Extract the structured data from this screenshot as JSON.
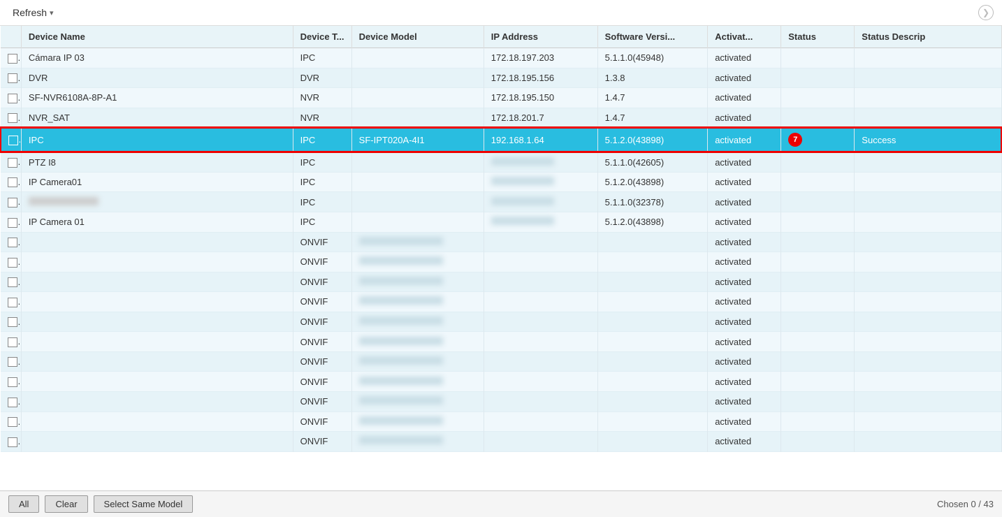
{
  "header": {
    "refresh_label": "Refresh",
    "circle_arrow": "❯"
  },
  "columns": [
    {
      "key": "checkbox",
      "label": ""
    },
    {
      "key": "device_name",
      "label": "Device Name"
    },
    {
      "key": "device_type",
      "label": "Device T..."
    },
    {
      "key": "device_model",
      "label": "Device Model"
    },
    {
      "key": "ip_address",
      "label": "IP Address"
    },
    {
      "key": "software_version",
      "label": "Software Versi..."
    },
    {
      "key": "activation",
      "label": "Activat..."
    },
    {
      "key": "status",
      "label": "Status"
    },
    {
      "key": "status_desc",
      "label": "Status Descrip"
    }
  ],
  "rows": [
    {
      "id": 1,
      "device_name": "Cámara IP 03",
      "device_type": "IPC",
      "device_model": "",
      "ip_address": "172.18.197.203",
      "software_version": "5.1.1.0(45948)",
      "activation": "activated",
      "status": "",
      "status_desc": "",
      "selected": false,
      "blurred_model": false,
      "blurred_ip": false
    },
    {
      "id": 2,
      "device_name": "DVR",
      "device_type": "DVR",
      "device_model": "",
      "ip_address": "172.18.195.156",
      "software_version": "1.3.8",
      "activation": "activated",
      "status": "",
      "status_desc": "",
      "selected": false,
      "blurred_model": false,
      "blurred_ip": false
    },
    {
      "id": 3,
      "device_name": "SF-NVR6108A-8P-A1",
      "device_type": "NVR",
      "device_model": "",
      "ip_address": "172.18.195.150",
      "software_version": "1.4.7",
      "activation": "activated",
      "status": "",
      "status_desc": "",
      "selected": false,
      "blurred_model": false,
      "blurred_ip": false
    },
    {
      "id": 4,
      "device_name": "NVR_SAT",
      "device_type": "NVR",
      "device_model": "",
      "ip_address": "172.18.201.7",
      "software_version": "1.4.7",
      "activation": "activated",
      "status": "",
      "status_desc": "",
      "selected": false,
      "blurred_model": false,
      "blurred_ip": false
    },
    {
      "id": 5,
      "device_name": "IPC",
      "device_type": "IPC",
      "device_model": "SF-IPT020A-4I1",
      "ip_address": "192.168.1.64",
      "software_version": "5.1.2.0(43898)",
      "activation": "activated",
      "status": "Success",
      "status_desc": "",
      "selected": true,
      "badge": "7",
      "blurred_model": false,
      "blurred_ip": false
    },
    {
      "id": 6,
      "device_name": "PTZ I8",
      "device_type": "IPC",
      "device_model": "",
      "ip_address": "",
      "software_version": "5.1.1.0(42605)",
      "activation": "activated",
      "status": "",
      "status_desc": "",
      "selected": false,
      "blurred_model": false,
      "blurred_ip": true
    },
    {
      "id": 7,
      "device_name": "IP Camera01",
      "device_type": "IPC",
      "device_model": "",
      "ip_address": "",
      "software_version": "5.1.2.0(43898)",
      "activation": "activated",
      "status": "",
      "status_desc": "",
      "selected": false,
      "blurred_model": false,
      "blurred_ip": true
    },
    {
      "id": 8,
      "device_name": "",
      "device_type": "IPC",
      "device_model": "",
      "ip_address": "",
      "software_version": "5.1.1.0(32378)",
      "activation": "activated",
      "status": "",
      "status_desc": "",
      "selected": false,
      "blurred_model": false,
      "blurred_ip": true,
      "blurred_name": true
    },
    {
      "id": 9,
      "device_name": "IP Camera 01",
      "device_type": "IPC",
      "device_model": "",
      "ip_address": "",
      "software_version": "5.1.2.0(43898)",
      "activation": "activated",
      "status": "",
      "status_desc": "",
      "selected": false,
      "blurred_model": false,
      "blurred_ip": true
    },
    {
      "id": 10,
      "device_name": "",
      "device_type": "ONVIF",
      "device_model": "",
      "ip_address": "",
      "software_version": "",
      "activation": "activated",
      "status": "",
      "status_desc": "",
      "selected": false,
      "blurred_model": true,
      "blurred_ip": false
    },
    {
      "id": 11,
      "device_name": "",
      "device_type": "ONVIF",
      "device_model": "",
      "ip_address": "",
      "software_version": "",
      "activation": "activated",
      "status": "",
      "status_desc": "",
      "selected": false,
      "blurred_model": true,
      "blurred_ip": false
    },
    {
      "id": 12,
      "device_name": "",
      "device_type": "ONVIF",
      "device_model": "",
      "ip_address": "",
      "software_version": "",
      "activation": "activated",
      "status": "",
      "status_desc": "",
      "selected": false,
      "blurred_model": true,
      "blurred_ip": false
    },
    {
      "id": 13,
      "device_name": "",
      "device_type": "ONVIF",
      "device_model": "",
      "ip_address": "",
      "software_version": "",
      "activation": "activated",
      "status": "",
      "status_desc": "",
      "selected": false,
      "blurred_model": true,
      "blurred_ip": false
    },
    {
      "id": 14,
      "device_name": "",
      "device_type": "ONVIF",
      "device_model": "",
      "ip_address": "",
      "software_version": "",
      "activation": "activated",
      "status": "",
      "status_desc": "",
      "selected": false,
      "blurred_model": true,
      "blurred_ip": false
    },
    {
      "id": 15,
      "device_name": "",
      "device_type": "ONVIF",
      "device_model": "",
      "ip_address": "",
      "software_version": "",
      "activation": "activated",
      "status": "",
      "status_desc": "",
      "selected": false,
      "blurred_model": true,
      "blurred_ip": false
    },
    {
      "id": 16,
      "device_name": "",
      "device_type": "ONVIF",
      "device_model": "",
      "ip_address": "",
      "software_version": "",
      "activation": "activated",
      "status": "",
      "status_desc": "",
      "selected": false,
      "blurred_model": true,
      "blurred_ip": false
    },
    {
      "id": 17,
      "device_name": "",
      "device_type": "ONVIF",
      "device_model": "",
      "ip_address": "",
      "software_version": "",
      "activation": "activated",
      "status": "",
      "status_desc": "",
      "selected": false,
      "blurred_model": true,
      "blurred_ip": false
    },
    {
      "id": 18,
      "device_name": "",
      "device_type": "ONVIF",
      "device_model": "",
      "ip_address": "",
      "software_version": "",
      "activation": "activated",
      "status": "",
      "status_desc": "",
      "selected": false,
      "blurred_model": true,
      "blurred_ip": false
    },
    {
      "id": 19,
      "device_name": "",
      "device_type": "ONVIF",
      "device_model": "",
      "ip_address": "",
      "software_version": "",
      "activation": "activated",
      "status": "",
      "status_desc": "",
      "selected": false,
      "blurred_model": true,
      "blurred_ip": false
    },
    {
      "id": 20,
      "device_name": "",
      "device_type": "ONVIF",
      "device_model": "",
      "ip_address": "",
      "software_version": "",
      "activation": "activated",
      "status": "",
      "status_desc": "",
      "selected": false,
      "blurred_model": true,
      "blurred_ip": false
    }
  ],
  "footer": {
    "all_label": "All",
    "clear_label": "Clear",
    "select_same_model_label": "Select Same Model",
    "chosen_text": "Chosen 0 / 43"
  }
}
